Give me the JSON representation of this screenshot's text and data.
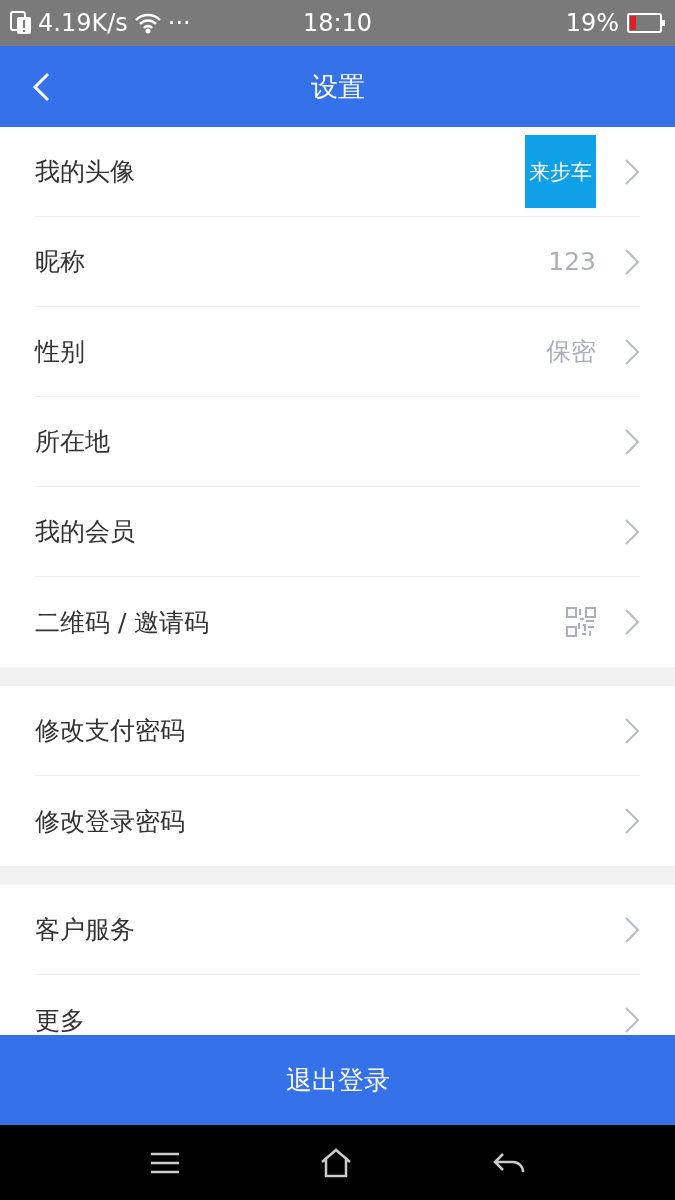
{
  "status_bar": {
    "speed": "4.19K/s",
    "more": "···",
    "time": "18:10",
    "battery": "19%"
  },
  "header": {
    "title": "设置"
  },
  "sections": [
    [
      {
        "kind": "avatar",
        "label": "我的头像",
        "value": "来步车"
      },
      {
        "kind": "text",
        "label": "昵称",
        "value": "123"
      },
      {
        "kind": "text",
        "label": "性别",
        "value": "保密"
      },
      {
        "kind": "plain",
        "label": "所在地"
      },
      {
        "kind": "plain",
        "label": "我的会员"
      },
      {
        "kind": "qr",
        "label": "二维码 / 邀请码"
      }
    ],
    [
      {
        "kind": "plain",
        "label": "修改支付密码"
      },
      {
        "kind": "plain",
        "label": "修改登录密码"
      }
    ],
    [
      {
        "kind": "plain",
        "label": "客户服务"
      },
      {
        "kind": "plain",
        "label": "更多"
      }
    ]
  ],
  "logout_button": "退出登录"
}
